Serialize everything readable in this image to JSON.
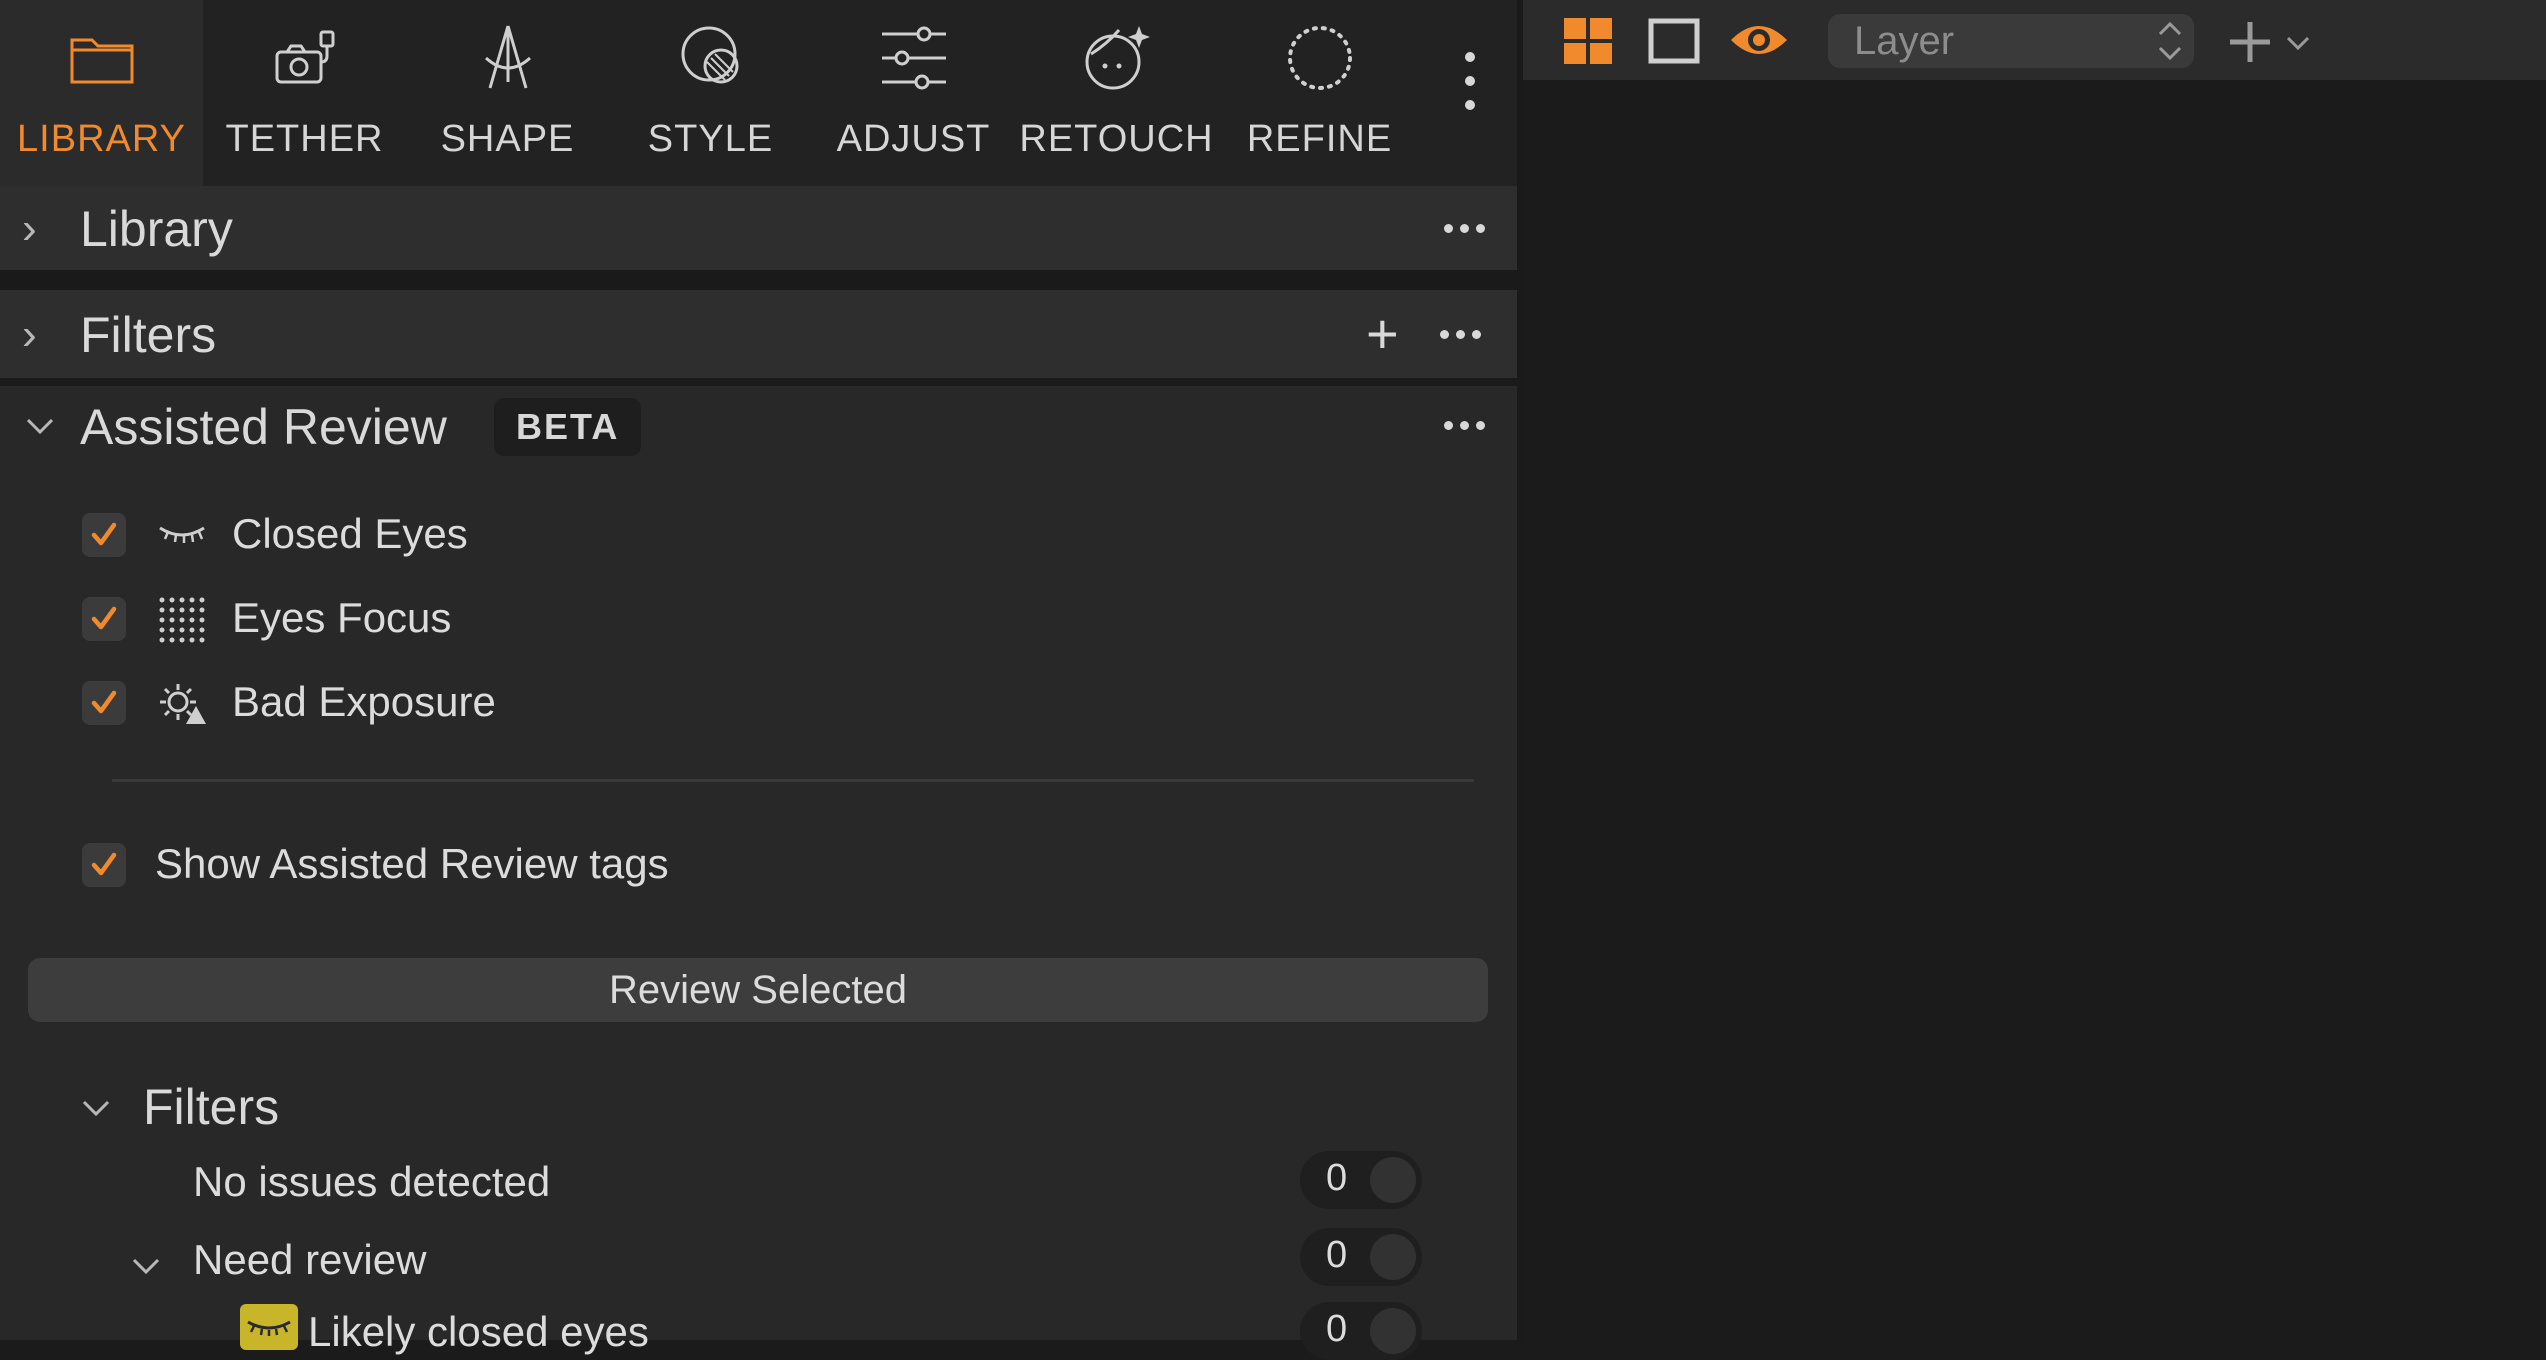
{
  "toolbar": {
    "tabs": [
      {
        "label": "LIBRARY",
        "icon": "folder-icon",
        "active": true
      },
      {
        "label": "TETHER",
        "icon": "camera-tether-icon",
        "active": false
      },
      {
        "label": "SHAPE",
        "icon": "shape-compass-icon",
        "active": false
      },
      {
        "label": "STYLE",
        "icon": "style-circle-icon",
        "active": false
      },
      {
        "label": "ADJUST",
        "icon": "sliders-icon",
        "active": false
      },
      {
        "label": "RETOUCH",
        "icon": "retouch-face-icon",
        "active": false
      },
      {
        "label": "REFINE",
        "icon": "refine-dotted-circle-icon",
        "active": false
      }
    ],
    "accent_color": "#f08a2c"
  },
  "sections": {
    "library": {
      "title": "Library"
    },
    "filters": {
      "title": "Filters"
    },
    "assisted_review": {
      "title": "Assisted Review",
      "badge": "BETA",
      "items": [
        {
          "label": "Closed Eyes",
          "icon": "closed-eye-icon",
          "checked": true
        },
        {
          "label": "Eyes Focus",
          "icon": "focus-grid-icon",
          "checked": true
        },
        {
          "label": "Bad Exposure",
          "icon": "exposure-icon",
          "checked": true
        }
      ],
      "show_tags": {
        "label": "Show Assisted Review tags",
        "checked": true
      },
      "review_button": "Review Selected",
      "sub_filters": {
        "title": "Filters",
        "rows": [
          {
            "label": "No issues detected",
            "count": "0"
          },
          {
            "label": "Need review",
            "count": "0"
          },
          {
            "label": "Likely closed eyes",
            "count": "0"
          }
        ]
      }
    }
  },
  "right_toolbar": {
    "layer_select": "Layer"
  }
}
